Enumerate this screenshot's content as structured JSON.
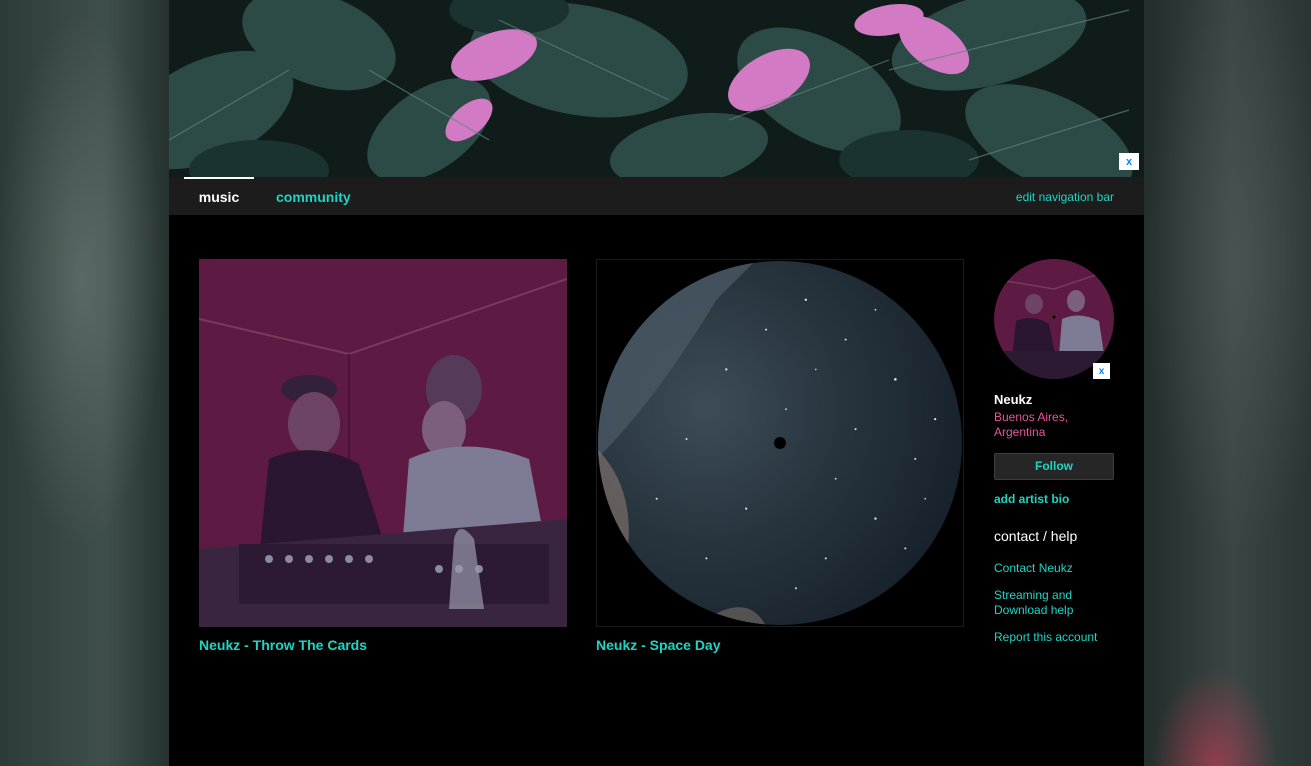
{
  "header": {
    "close_label": "x"
  },
  "nav": {
    "tabs": [
      {
        "label": "music",
        "active": true
      },
      {
        "label": "community",
        "active": false
      }
    ],
    "edit_label": "edit navigation bar"
  },
  "albums": [
    {
      "title": "Neukz - Throw The Cards"
    },
    {
      "title": "Neukz - Space Day"
    }
  ],
  "artist": {
    "name": "Neukz",
    "location": "Buenos Aires, Argentina",
    "follow_label": "Follow",
    "add_bio_label": "add artist bio",
    "avatar_close_label": "x"
  },
  "contact": {
    "heading": "contact / help",
    "links": [
      "Contact Neukz",
      "Streaming and Download help",
      "Report this account"
    ]
  },
  "colors": {
    "accent": "#1ed5c4",
    "location": "#e8549e",
    "close_x": "#0687f5"
  }
}
